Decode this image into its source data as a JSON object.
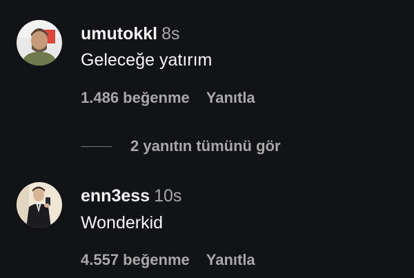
{
  "comments": [
    {
      "username": "umutokkl",
      "time": "8s",
      "text": "Geleceğe yatırım",
      "likes": "1.486 beğenme",
      "reply": "Yanıtla"
    },
    {
      "username": "enn3ess",
      "time": "10s",
      "text": "Wonderkid",
      "likes": "4.557 beğenme",
      "reply": "Yanıtla"
    }
  ],
  "view_replies": "2 yanıtın tümünü gör",
  "colors": {
    "background": "#121317",
    "primary_text": "#f5f5f5",
    "secondary_text": "#a8a8a8"
  }
}
